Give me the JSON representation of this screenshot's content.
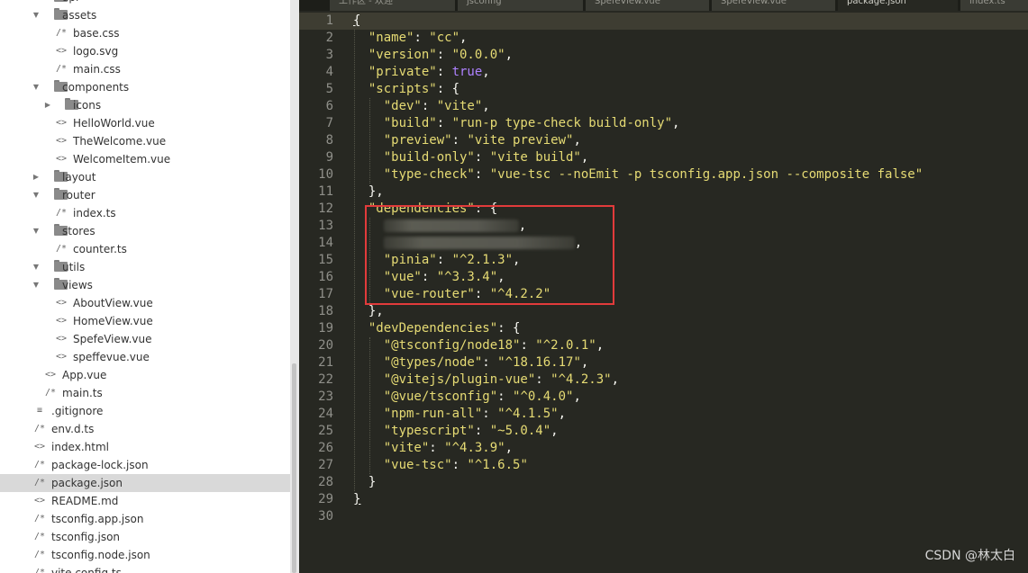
{
  "tabs": [
    {
      "label": "工作区 - 欢迎",
      "active": false
    },
    {
      "label": "jsconfig",
      "active": false
    },
    {
      "label": "SpefeView.vue",
      "active": false
    },
    {
      "label": "SpefeView.vue",
      "active": false
    },
    {
      "label": "package.json",
      "active": true
    },
    {
      "label": "index.ts",
      "active": false
    }
  ],
  "sidebar": {
    "items": [
      {
        "label": "api",
        "type": "folder",
        "depth": 1,
        "expanded": false
      },
      {
        "label": "assets",
        "type": "folder",
        "depth": 1,
        "expanded": true
      },
      {
        "label": "base.css",
        "type": "file",
        "icon": "/*",
        "depth": 2
      },
      {
        "label": "logo.svg",
        "type": "file",
        "icon": "<>",
        "depth": 2
      },
      {
        "label": "main.css",
        "type": "file",
        "icon": "/*",
        "depth": 2
      },
      {
        "label": "components",
        "type": "folder",
        "depth": 1,
        "expanded": true
      },
      {
        "label": "icons",
        "type": "folder",
        "depth": 2,
        "expanded": false
      },
      {
        "label": "HelloWorld.vue",
        "type": "file",
        "icon": "<>",
        "depth": 2
      },
      {
        "label": "TheWelcome.vue",
        "type": "file",
        "icon": "<>",
        "depth": 2
      },
      {
        "label": "WelcomeItem.vue",
        "type": "file",
        "icon": "<>",
        "depth": 2
      },
      {
        "label": "layout",
        "type": "folder",
        "depth": 1,
        "expanded": false
      },
      {
        "label": "router",
        "type": "folder",
        "depth": 1,
        "expanded": true
      },
      {
        "label": "index.ts",
        "type": "file",
        "icon": "/*",
        "depth": 2
      },
      {
        "label": "stores",
        "type": "folder",
        "depth": 1,
        "expanded": true
      },
      {
        "label": "counter.ts",
        "type": "file",
        "icon": "/*",
        "depth": 2
      },
      {
        "label": "utils",
        "type": "folder",
        "depth": 1,
        "expanded": true
      },
      {
        "label": "views",
        "type": "folder",
        "depth": 1,
        "expanded": true
      },
      {
        "label": "AboutView.vue",
        "type": "file",
        "icon": "<>",
        "depth": 2
      },
      {
        "label": "HomeView.vue",
        "type": "file",
        "icon": "<>",
        "depth": 2
      },
      {
        "label": "SpefeView.vue",
        "type": "file",
        "icon": "<>",
        "depth": 2
      },
      {
        "label": "speffevue.vue",
        "type": "file",
        "icon": "<>",
        "depth": 2
      },
      {
        "label": "App.vue",
        "type": "file",
        "icon": "<>",
        "depth": 1
      },
      {
        "label": "main.ts",
        "type": "file",
        "icon": "/*",
        "depth": 1
      },
      {
        "label": ".gitignore",
        "type": "file",
        "icon": "≡",
        "depth": 0
      },
      {
        "label": "env.d.ts",
        "type": "file",
        "icon": "/*",
        "depth": 0
      },
      {
        "label": "index.html",
        "type": "file",
        "icon": "<>",
        "depth": 0
      },
      {
        "label": "package-lock.json",
        "type": "file",
        "icon": "/*",
        "depth": 0
      },
      {
        "label": "package.json",
        "type": "file",
        "icon": "/*",
        "depth": 0,
        "selected": true
      },
      {
        "label": "README.md",
        "type": "file",
        "icon": "<>",
        "depth": 0
      },
      {
        "label": "tsconfig.app.json",
        "type": "file",
        "icon": "/*",
        "depth": 0
      },
      {
        "label": "tsconfig.json",
        "type": "file",
        "icon": "/*",
        "depth": 0
      },
      {
        "label": "tsconfig.node.json",
        "type": "file",
        "icon": "/*",
        "depth": 0
      },
      {
        "label": "vite.config.ts",
        "type": "file",
        "icon": "/*",
        "depth": 0
      }
    ]
  },
  "editor": {
    "lines": [
      [
        {
          "t": "{",
          "c": "p",
          "u": true
        }
      ],
      [
        {
          "t": "  \"name\"",
          "c": "k"
        },
        {
          "t": ": ",
          "c": "p"
        },
        {
          "t": "\"cc\"",
          "c": "v"
        },
        {
          "t": ",",
          "c": "p"
        }
      ],
      [
        {
          "t": "  \"version\"",
          "c": "k"
        },
        {
          "t": ": ",
          "c": "p"
        },
        {
          "t": "\"0.0.0\"",
          "c": "v"
        },
        {
          "t": ",",
          "c": "p"
        }
      ],
      [
        {
          "t": "  \"private\"",
          "c": "k"
        },
        {
          "t": ": ",
          "c": "p"
        },
        {
          "t": "true",
          "c": "b"
        },
        {
          "t": ",",
          "c": "p"
        }
      ],
      [
        {
          "t": "  \"scripts\"",
          "c": "k"
        },
        {
          "t": ": {",
          "c": "p"
        }
      ],
      [
        {
          "t": "    \"dev\"",
          "c": "k"
        },
        {
          "t": ": ",
          "c": "p"
        },
        {
          "t": "\"vite\"",
          "c": "v"
        },
        {
          "t": ",",
          "c": "p"
        }
      ],
      [
        {
          "t": "    \"build\"",
          "c": "k"
        },
        {
          "t": ": ",
          "c": "p"
        },
        {
          "t": "\"run-p type-check build-only\"",
          "c": "v"
        },
        {
          "t": ",",
          "c": "p"
        }
      ],
      [
        {
          "t": "    \"preview\"",
          "c": "k"
        },
        {
          "t": ": ",
          "c": "p"
        },
        {
          "t": "\"vite preview\"",
          "c": "v"
        },
        {
          "t": ",",
          "c": "p"
        }
      ],
      [
        {
          "t": "    \"build-only\"",
          "c": "k"
        },
        {
          "t": ": ",
          "c": "p"
        },
        {
          "t": "\"vite build\"",
          "c": "v"
        },
        {
          "t": ",",
          "c": "p"
        }
      ],
      [
        {
          "t": "    \"type-check\"",
          "c": "k"
        },
        {
          "t": ": ",
          "c": "p"
        },
        {
          "t": "\"vue-tsc --noEmit -p tsconfig.app.json --composite false\"",
          "c": "v"
        }
      ],
      [
        {
          "t": "  },",
          "c": "p"
        }
      ],
      [
        {
          "t": "  \"dependencies\"",
          "c": "k"
        },
        {
          "t": ": {",
          "c": "p"
        }
      ],
      [
        {
          "t": "    ",
          "c": "p"
        },
        {
          "blur": 150
        },
        {
          "t": ",",
          "c": "p"
        }
      ],
      [
        {
          "t": "    ",
          "c": "p"
        },
        {
          "blur": 212
        },
        {
          "t": ",",
          "c": "p"
        }
      ],
      [
        {
          "t": "    \"pinia\"",
          "c": "k"
        },
        {
          "t": ": ",
          "c": "p"
        },
        {
          "t": "\"^2.1.3\"",
          "c": "v"
        },
        {
          "t": ",",
          "c": "p"
        }
      ],
      [
        {
          "t": "    \"vue\"",
          "c": "k"
        },
        {
          "t": ": ",
          "c": "p"
        },
        {
          "t": "\"^3.3.4\"",
          "c": "v"
        },
        {
          "t": ",",
          "c": "p"
        }
      ],
      [
        {
          "t": "    \"vue-router\"",
          "c": "k"
        },
        {
          "t": ": ",
          "c": "p"
        },
        {
          "t": "\"^4.2.2\"",
          "c": "v"
        }
      ],
      [
        {
          "t": "  },",
          "c": "p"
        }
      ],
      [
        {
          "t": "  \"devDependencies\"",
          "c": "k"
        },
        {
          "t": ": {",
          "c": "p"
        }
      ],
      [
        {
          "t": "    \"@tsconfig/node18\"",
          "c": "k"
        },
        {
          "t": ": ",
          "c": "p"
        },
        {
          "t": "\"^2.0.1\"",
          "c": "v"
        },
        {
          "t": ",",
          "c": "p"
        }
      ],
      [
        {
          "t": "    \"@types/node\"",
          "c": "k"
        },
        {
          "t": ": ",
          "c": "p"
        },
        {
          "t": "\"^18.16.17\"",
          "c": "v"
        },
        {
          "t": ",",
          "c": "p"
        }
      ],
      [
        {
          "t": "    \"@vitejs/plugin-vue\"",
          "c": "k"
        },
        {
          "t": ": ",
          "c": "p"
        },
        {
          "t": "\"^4.2.3\"",
          "c": "v"
        },
        {
          "t": ",",
          "c": "p"
        }
      ],
      [
        {
          "t": "    \"@vue/tsconfig\"",
          "c": "k"
        },
        {
          "t": ": ",
          "c": "p"
        },
        {
          "t": "\"^0.4.0\"",
          "c": "v"
        },
        {
          "t": ",",
          "c": "p"
        }
      ],
      [
        {
          "t": "    \"npm-run-all\"",
          "c": "k"
        },
        {
          "t": ": ",
          "c": "p"
        },
        {
          "t": "\"^4.1.5\"",
          "c": "v"
        },
        {
          "t": ",",
          "c": "p"
        }
      ],
      [
        {
          "t": "    \"typescript\"",
          "c": "k"
        },
        {
          "t": ": ",
          "c": "p"
        },
        {
          "t": "\"~5.0.4\"",
          "c": "v"
        },
        {
          "t": ",",
          "c": "p"
        }
      ],
      [
        {
          "t": "    \"vite\"",
          "c": "k"
        },
        {
          "t": ": ",
          "c": "p"
        },
        {
          "t": "\"^4.3.9\"",
          "c": "v"
        },
        {
          "t": ",",
          "c": "p"
        }
      ],
      [
        {
          "t": "    \"vue-tsc\"",
          "c": "k"
        },
        {
          "t": ": ",
          "c": "p"
        },
        {
          "t": "\"^1.6.5\"",
          "c": "v"
        }
      ],
      [
        {
          "t": "  }",
          "c": "p"
        }
      ],
      [
        {
          "t": "}",
          "c": "p",
          "u": true
        }
      ],
      []
    ]
  },
  "colors": {
    "editor_bg": "#272822",
    "key": "#e6db74",
    "string": "#e6db74",
    "boolean": "#ae81ff",
    "line_number": "#90908a",
    "highlight_box": "#e23b3b"
  },
  "watermark": "CSDN @林太白"
}
